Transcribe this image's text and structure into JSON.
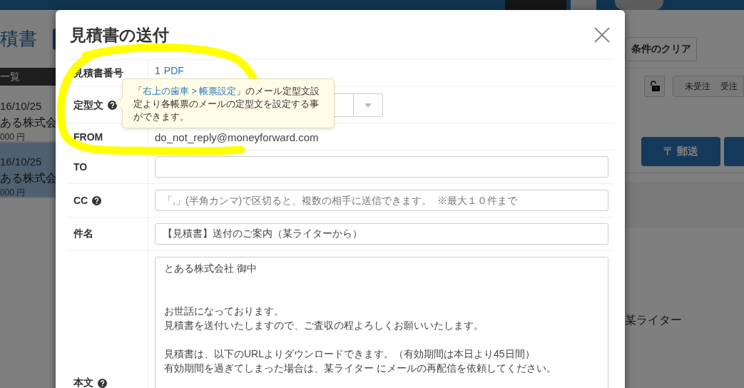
{
  "page": {
    "title": "積書",
    "list_header": "一覧",
    "list_items": [
      {
        "date": "16/10/25",
        "company": "ある株式会",
        "amount": "000 円",
        "selected": false
      },
      {
        "date": "16/10/25",
        "company": "ある株式会",
        "amount": "000 円",
        "selected": true
      }
    ],
    "clear_button": "条件のクリア",
    "status_tabs": [
      {
        "label": "未受注",
        "selected": false
      },
      {
        "label": "受注",
        "selected": false
      }
    ],
    "mail_button": {
      "icon": "〒",
      "label": "郵送"
    },
    "sender_name": "某ライター"
  },
  "dialog": {
    "title": "見積書の送付",
    "rows": [
      {
        "kind": "link",
        "label": "見積書番号",
        "help": false,
        "number": "1",
        "link": "PDF"
      },
      {
        "kind": "select",
        "label": "定型文",
        "help": true
      },
      {
        "kind": "text",
        "label": "FROM",
        "help": false,
        "value": "do_not_reply@moneyforward.com"
      },
      {
        "kind": "input",
        "label": "TO",
        "help": false
      },
      {
        "kind": "input",
        "label": "CC",
        "help": true,
        "placeholder": "「,」(半角カンマ)で区切ると、複数の相手に送信できます。  ※最大１０件まで"
      },
      {
        "kind": "input",
        "label": "件名",
        "help": false,
        "value": "【見積書】送付のご案内（某ライターから）"
      },
      {
        "kind": "textarea",
        "label": "本文",
        "help": true,
        "paragraphs": [
          [
            "とある株式会社 御中"
          ],
          [
            "お世話になっております。",
            "見積書を送付いたしますので、ご査収の程よろしくお願いいたします。"
          ],
          [
            "見積書は、以下のURLよりダウンロードできます。（有効期間は本日より45日間）",
            "有効期間を過ぎてしまった場合は、某ライター にメールの再配信を依頼してください。"
          ]
        ]
      }
    ],
    "tooltip": {
      "before": "「",
      "link": "右上の歯車 > 帳票設定",
      "after": "」のメール定型文設定より各帳票のメールの定型文を設定する事ができます。"
    }
  }
}
